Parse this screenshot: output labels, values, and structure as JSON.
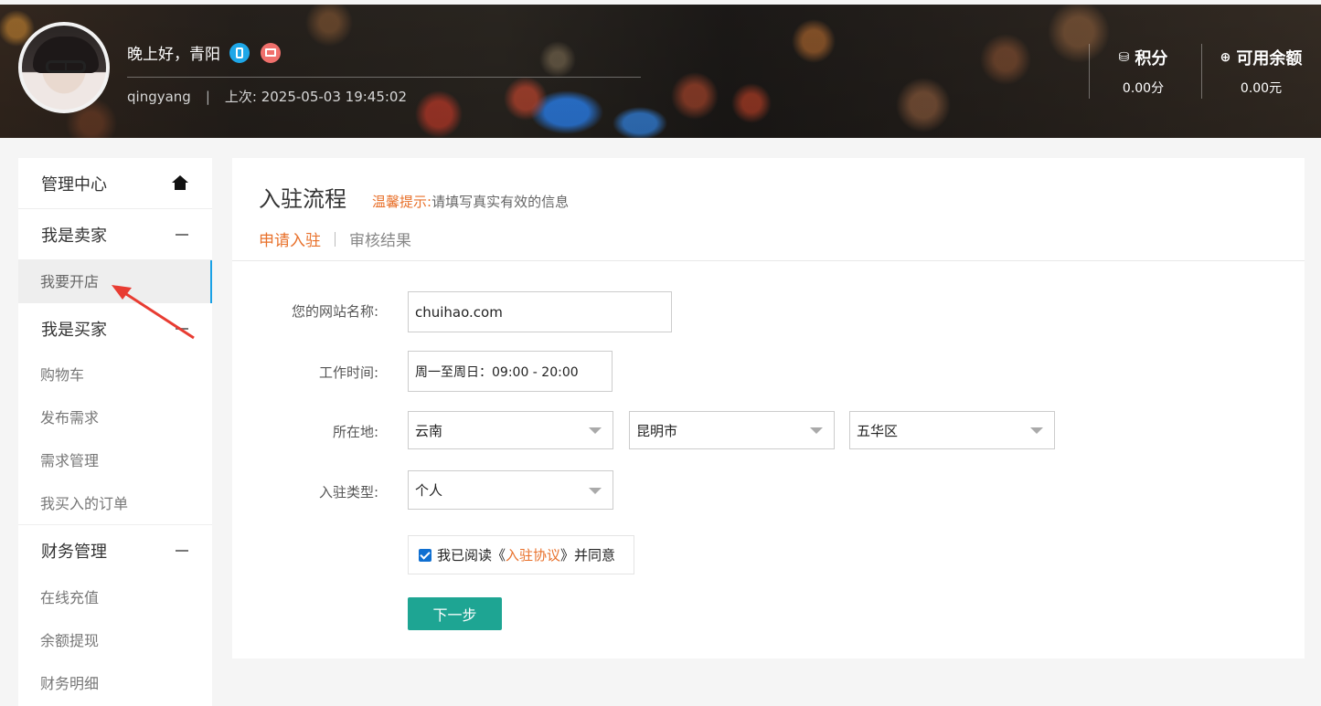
{
  "header": {
    "greeting": "晚上好，青阳",
    "username": "qingyang",
    "separator": "|",
    "last_login": "上次: 2025-05-03 19:45:02",
    "stats": [
      {
        "title": "积分",
        "value": "0.00分",
        "icon": "coin-stack-icon"
      },
      {
        "title": "可用余额",
        "value": "0.00元",
        "icon": "wallet-icon"
      }
    ]
  },
  "sidebar": {
    "groups": [
      {
        "label": "管理中心",
        "icon": "home-icon",
        "items": []
      },
      {
        "label": "我是卖家",
        "icon": "minus-icon",
        "items": [
          {
            "label": "我要开店",
            "active": true
          }
        ]
      },
      {
        "label": "我是买家",
        "icon": "minus-icon",
        "items": [
          {
            "label": "购物车"
          },
          {
            "label": "发布需求"
          },
          {
            "label": "需求管理"
          },
          {
            "label": "我买入的订单"
          }
        ]
      },
      {
        "label": "财务管理",
        "icon": "minus-icon",
        "items": [
          {
            "label": "在线充值"
          },
          {
            "label": "余额提现"
          },
          {
            "label": "财务明细"
          }
        ]
      }
    ]
  },
  "main": {
    "title": "入驻流程",
    "tip_label": "温馨提示:",
    "tip_text": "请填写真实有效的信息",
    "tabs": [
      {
        "label": "申请入驻",
        "active": true
      },
      {
        "label": "审核结果",
        "active": false
      }
    ],
    "form": {
      "site_name_label": "您的网站名称:",
      "site_name_value": "chuihao.com",
      "work_time_label": "工作时间:",
      "work_time_value": "周一至周日：09:00 - 20:00",
      "location_label": "所在地:",
      "province": "云南",
      "city": "昆明市",
      "district": "五华区",
      "type_label": "入驻类型:",
      "type_value": "个人",
      "agree_prefix": "我已阅读《",
      "agree_link": "入驻协议",
      "agree_suffix": "》并同意",
      "agree_checked": true,
      "next_label": "下一步"
    }
  },
  "colors": {
    "accent": "#e8702a",
    "button": "#1ea593",
    "active_border": "#1aa1e6",
    "arrow": "#e83c32"
  }
}
